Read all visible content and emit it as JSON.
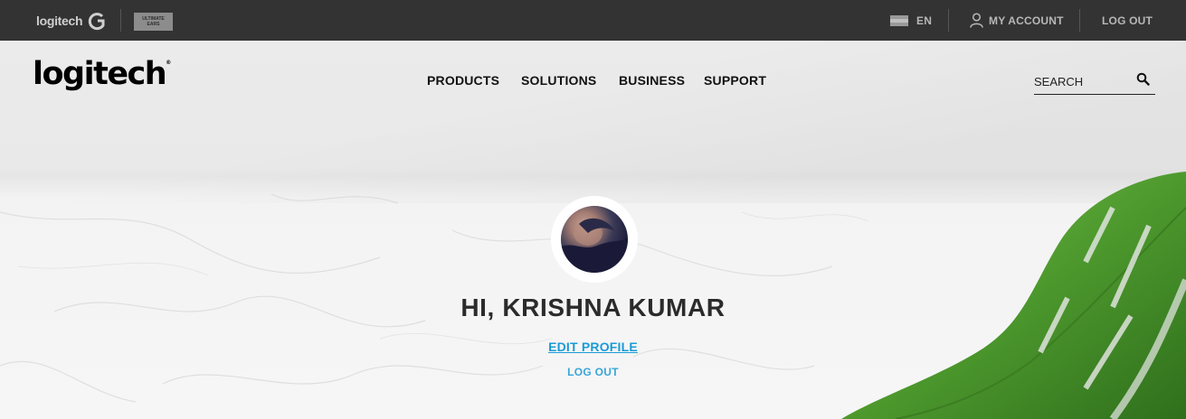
{
  "topbar": {
    "brand": "logitech",
    "sub_brand_badge": [
      "ULTIMATE",
      "EARS"
    ],
    "language": "EN",
    "my_account": "MY ACCOUNT",
    "log_out": "LOG OUT",
    "background": "#333333"
  },
  "header": {
    "logo": "logitech",
    "nav": [
      "PRODUCTS",
      "SOLUTIONS",
      "BUSINESS",
      "SUPPORT"
    ],
    "search_placeholder": "SEARCH"
  },
  "profile": {
    "greeting": "HI, KRISHNA KUMAR",
    "edit_profile": "EDIT PROFILE",
    "log_out": "LOG OUT",
    "link_color": "#1a9bd7"
  },
  "icons": {
    "g_logo": "logitech-g-icon",
    "flag": "flag-icon",
    "account": "user-icon",
    "search": "search-icon"
  }
}
